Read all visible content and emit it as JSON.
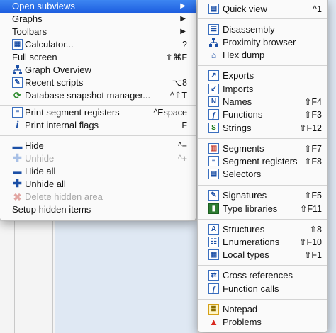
{
  "main_menu": {
    "group1": [
      {
        "label": "Open subviews",
        "arrow": "▶"
      },
      {
        "label": "Graphs",
        "arrow": "▶"
      },
      {
        "label": "Toolbars",
        "arrow": "▶"
      },
      {
        "label": "Calculator...",
        "shortcut": "?"
      },
      {
        "label": "Full screen",
        "shortcut": "⇧⌘F"
      },
      {
        "label": "Graph Overview"
      },
      {
        "label": "Recent scripts",
        "shortcut": "⌥8"
      },
      {
        "label": "Database snapshot manager...",
        "shortcut": "^⇧T"
      }
    ],
    "group2": [
      {
        "label": "Print segment registers",
        "shortcut": "^Espace"
      },
      {
        "label": "Print internal flags",
        "shortcut": "F"
      }
    ],
    "group3": [
      {
        "label": "Hide",
        "shortcut": "^−"
      },
      {
        "label": "Unhide",
        "shortcut": "^+"
      },
      {
        "label": "Hide all"
      },
      {
        "label": "Unhide all"
      },
      {
        "label": "Delete hidden area"
      },
      {
        "label": "Setup hidden items"
      }
    ]
  },
  "sub_menu": {
    "g1": [
      {
        "label": "Quick view",
        "shortcut": "^1"
      }
    ],
    "g2": [
      {
        "label": "Disassembly"
      },
      {
        "label": "Proximity browser"
      },
      {
        "label": "Hex dump"
      }
    ],
    "g3": [
      {
        "label": "Exports"
      },
      {
        "label": "Imports"
      },
      {
        "label": "Names",
        "shortcut": "⇧F4"
      },
      {
        "label": "Functions",
        "shortcut": "⇧F3"
      },
      {
        "label": "Strings",
        "shortcut": "⇧F12"
      }
    ],
    "g4": [
      {
        "label": "Segments",
        "shortcut": "⇧F7"
      },
      {
        "label": "Segment registers",
        "shortcut": "⇧F8"
      },
      {
        "label": "Selectors"
      }
    ],
    "g5": [
      {
        "label": "Signatures",
        "shortcut": "⇧F5"
      },
      {
        "label": "Type libraries",
        "shortcut": "⇧F11"
      }
    ],
    "g6": [
      {
        "label": "Structures",
        "shortcut": "⇧8"
      },
      {
        "label": "Enumerations",
        "shortcut": "⇧F10"
      },
      {
        "label": "Local types",
        "shortcut": "⇧F1"
      }
    ],
    "g7": [
      {
        "label": "Cross references"
      },
      {
        "label": "Function calls"
      }
    ],
    "g8": [
      {
        "label": "Notepad"
      },
      {
        "label": "Problems"
      }
    ]
  },
  "colors": {
    "selection": "#2a6de6",
    "icon_blue": "#2f66c7",
    "delete_red": "#d8281e"
  }
}
